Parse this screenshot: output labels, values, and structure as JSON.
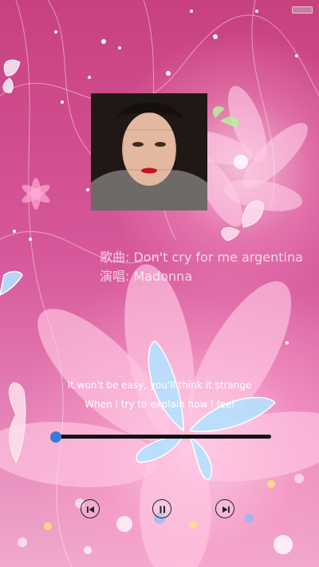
{
  "song": {
    "title_line": "歌曲: Don't cry for me argentina",
    "artist_line": "演唱: Madonna"
  },
  "lyrics": {
    "line1": "It won't be easy, you'll think it strange",
    "line2": "When I try to explain how I feel"
  },
  "playback": {
    "progress": 0.02
  },
  "controls": {
    "prev_icon": "skip-previous-icon",
    "pause_icon": "pause-icon",
    "next_icon": "skip-next-icon"
  },
  "colors": {
    "background": "#d6589a",
    "progress_thumb": "#3a7ad6",
    "progress_track": "#0f0f0f"
  }
}
